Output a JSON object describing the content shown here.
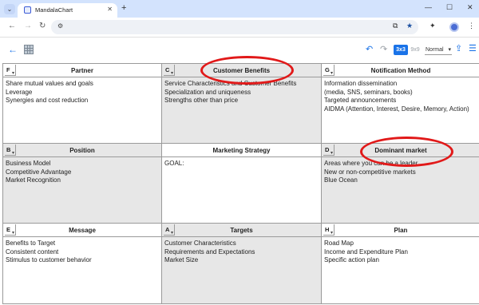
{
  "browser": {
    "tab_title": "MandalaChart",
    "new_tab_glyph": "+",
    "close_glyph": "✕",
    "window_controls": [
      "—",
      "☐",
      "✕"
    ]
  },
  "app_toolbar": {
    "mode_3x3": "3x3",
    "mode_9x9": "9x9",
    "view_select": "Normal"
  },
  "cells": [
    {
      "letter": "F",
      "title": "Partner",
      "lines": [
        "Share mutual values and goals",
        "Leverage",
        "Synergies and cost reduction"
      ]
    },
    {
      "letter": "C",
      "title": "Customer Benefits",
      "lines": [
        "Service Characteristics and Customer Benefits",
        "Specialization and uniqueness",
        "Strengths other than price"
      ]
    },
    {
      "letter": "G",
      "title": "Notification Method",
      "lines": [
        "Information dissemination",
        "(media, SNS, seminars, books)",
        "Targeted announcements",
        "AIDMA (Attention, Interest, Desire, Memory, Action)"
      ]
    },
    {
      "letter": "B",
      "title": "Position",
      "lines": [
        "Business Model",
        "Competitive Advantage",
        "Market Recognition"
      ]
    },
    {
      "letter": "",
      "title": "Marketing Strategy",
      "lines": [
        "GOAL:"
      ]
    },
    {
      "letter": "D",
      "title": "Dominant market",
      "lines": [
        "Areas where you can be a leader",
        "New or non-competitive markets",
        "Blue Ocean"
      ]
    },
    {
      "letter": "E",
      "title": "Message",
      "lines": [
        "Benefits to Target",
        "Consistent content",
        "Stimulus to customer behavior"
      ]
    },
    {
      "letter": "A",
      "title": "Targets",
      "lines": [
        "Customer Characteristics",
        "Requirements and Expectations",
        "Market Size"
      ]
    },
    {
      "letter": "H",
      "title": "Plan",
      "lines": [
        "Road Map",
        "Income and Expenditure Plan",
        "Specific action plan"
      ]
    }
  ],
  "colors": {
    "accent": "#1a73e8",
    "highlight_ellipse": "#e11919",
    "shaded_cell": "#e7e7e7"
  },
  "icons": [
    "tab-menu-icon",
    "back-icon",
    "forward-icon",
    "reload-icon",
    "site-settings-icon",
    "install-icon",
    "bookmark-star-icon",
    "extensions-icon",
    "more-icon",
    "app-back-icon",
    "app-logo-icon",
    "undo-icon",
    "redo-icon",
    "share-icon",
    "hamburger-menu-icon"
  ]
}
